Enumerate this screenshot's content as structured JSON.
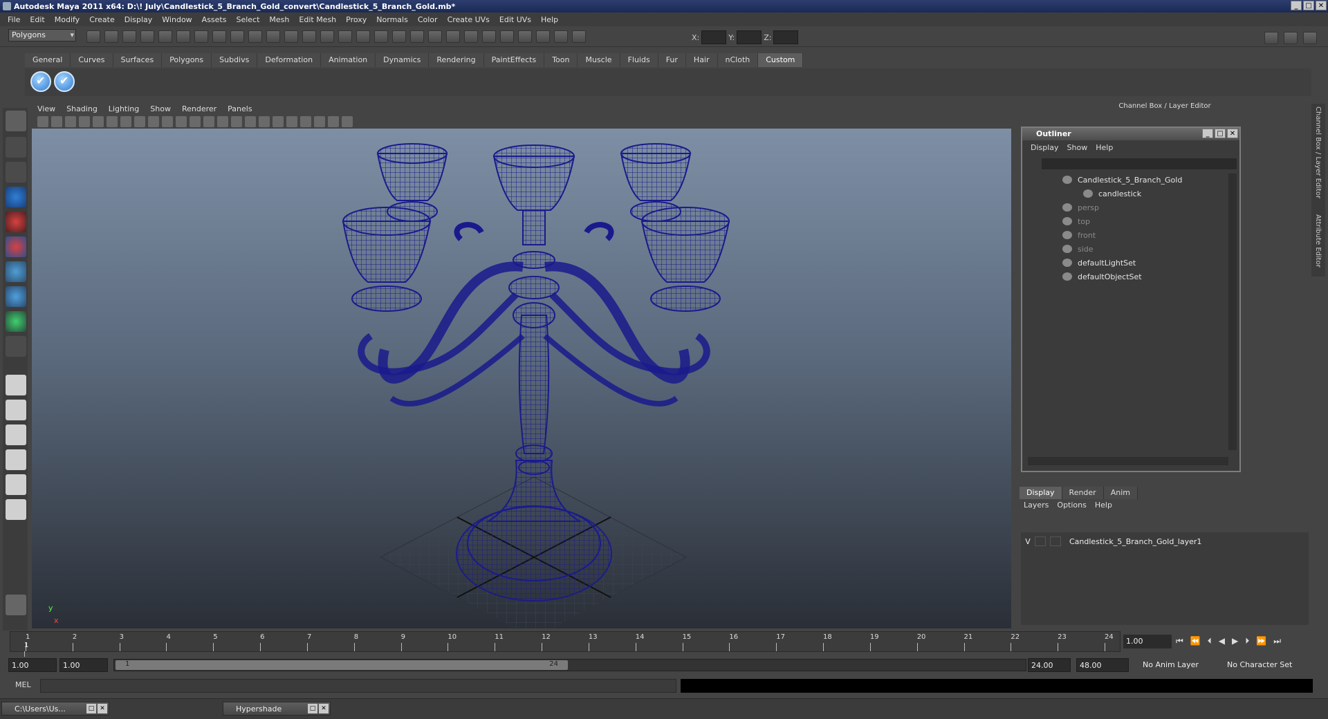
{
  "window": {
    "title": "Autodesk Maya 2011 x64: D:\\! July\\Candlestick_5_Branch_Gold_convert\\Candlestick_5_Branch_Gold.mb*",
    "min": "_",
    "max": "□",
    "close": "✕"
  },
  "menubar": [
    "File",
    "Edit",
    "Modify",
    "Create",
    "Display",
    "Window",
    "Assets",
    "Select",
    "Mesh",
    "Edit Mesh",
    "Proxy",
    "Normals",
    "Color",
    "Create UVs",
    "Edit UVs",
    "Help"
  ],
  "statusline": {
    "mode": "Polygons",
    "x_label": "X:",
    "y_label": "Y:",
    "z_label": "Z:"
  },
  "shelf": {
    "tabs": [
      "General",
      "Curves",
      "Surfaces",
      "Polygons",
      "Subdivs",
      "Deformation",
      "Animation",
      "Dynamics",
      "Rendering",
      "PaintEffects",
      "Toon",
      "Muscle",
      "Fluids",
      "Fur",
      "Hair",
      "nCloth",
      "Custom"
    ],
    "active_tab": "Custom"
  },
  "viewport": {
    "menu": [
      "View",
      "Shading",
      "Lighting",
      "Show",
      "Renderer",
      "Panels"
    ],
    "axis_y": "y",
    "axis_x": "x",
    "wire_color": "#1a1a8c"
  },
  "channel_box": {
    "title": "Channel Box / Layer Editor",
    "side_tabs": [
      "Channel Box / Layer Editor",
      "Attribute Editor"
    ]
  },
  "outliner": {
    "title": "Outliner",
    "menu": [
      "Display",
      "Show",
      "Help"
    ],
    "items": [
      {
        "label": "Candlestick_5_Branch_Gold",
        "dim": false,
        "icon": "transform-icon"
      },
      {
        "label": "candlestick",
        "dim": false,
        "icon": "mesh-icon"
      },
      {
        "label": "persp",
        "dim": true,
        "icon": "camera-icon"
      },
      {
        "label": "top",
        "dim": true,
        "icon": "camera-icon"
      },
      {
        "label": "front",
        "dim": true,
        "icon": "camera-icon"
      },
      {
        "label": "side",
        "dim": true,
        "icon": "camera-icon"
      },
      {
        "label": "defaultLightSet",
        "dim": false,
        "icon": "set-icon"
      },
      {
        "label": "defaultObjectSet",
        "dim": false,
        "icon": "set-icon"
      }
    ]
  },
  "layer_editor": {
    "tabs": [
      "Display",
      "Render",
      "Anim"
    ],
    "active_tab": "Display",
    "menu": [
      "Layers",
      "Options",
      "Help"
    ],
    "layer": {
      "visible": "V",
      "name": "Candlestick_5_Branch_Gold_layer1"
    }
  },
  "timeline": {
    "ticks": [
      "1",
      "2",
      "3",
      "4",
      "5",
      "6",
      "7",
      "8",
      "9",
      "10",
      "11",
      "12",
      "13",
      "14",
      "15",
      "16",
      "17",
      "18",
      "19",
      "20",
      "21",
      "22",
      "23",
      "24"
    ],
    "current_frame_marker": "1",
    "current_time": "1.00"
  },
  "range": {
    "start": "1.00",
    "playback_start": "1.00",
    "slider_start": "1",
    "slider_end": "24",
    "playback_end": "24.00",
    "end": "48.00",
    "anim_layer": "No Anim Layer",
    "character_set": "No Character Set"
  },
  "command_line": {
    "label": "MEL"
  },
  "taskbar": [
    {
      "label": "C:\\Users\\Us..."
    },
    {
      "label": "Hypershade"
    }
  ]
}
